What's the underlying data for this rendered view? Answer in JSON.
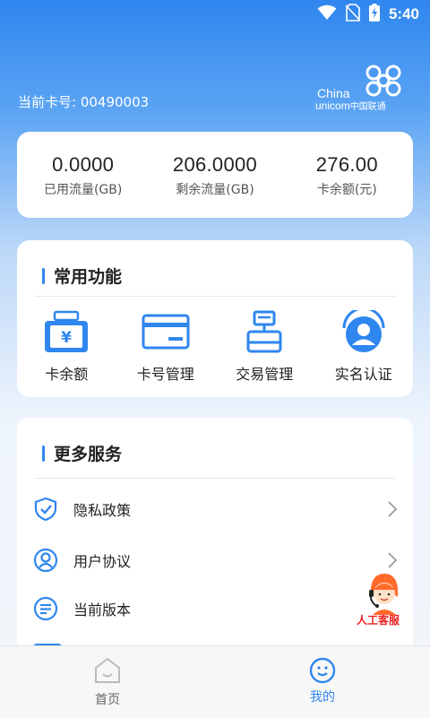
{
  "status_bar": {
    "time": "5:40"
  },
  "header": {
    "card_number": "当前卡号: 00490003",
    "brand": {
      "en_line1": "China",
      "en_line2": "unicom",
      "cn": "中国联通"
    }
  },
  "stats": [
    {
      "value": "0.0000",
      "label": "已用流量(GB)"
    },
    {
      "value": "206.0000",
      "label": "剩余流量(GB)"
    },
    {
      "value": "276.00",
      "label": "卡余额(元)"
    }
  ],
  "common_functions": {
    "title": "常用功能",
    "items": [
      {
        "label": "卡余额",
        "icon": "wallet-yen-icon"
      },
      {
        "label": "卡号管理",
        "icon": "card-icon"
      },
      {
        "label": "交易管理",
        "icon": "transaction-icon"
      },
      {
        "label": "实名认证",
        "icon": "user-verify-icon"
      }
    ]
  },
  "more_services": {
    "title": "更多服务",
    "items": [
      {
        "label": "隐私政策",
        "icon": "shield-check-icon"
      },
      {
        "label": "用户协议",
        "icon": "user-circle-icon"
      },
      {
        "label": "当前版本",
        "icon": "version-icon"
      }
    ]
  },
  "customer_service": {
    "label": "人工客服"
  },
  "bottom_nav": [
    {
      "label": "首页",
      "active": false
    },
    {
      "label": "我的",
      "active": true
    }
  ],
  "colors": {
    "accent": "#2f86ee",
    "cs_red": "#e22222",
    "nav_inactive": "#666666"
  }
}
